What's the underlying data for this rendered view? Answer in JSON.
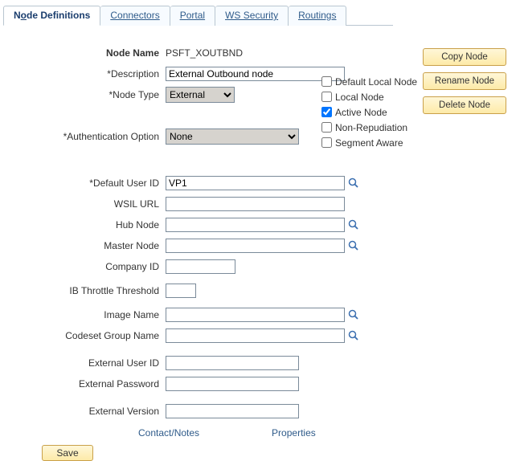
{
  "tabs": [
    {
      "label_pre": "N",
      "label_u": "o",
      "label_post": "de Definitions"
    },
    {
      "label_pre": "",
      "label_u": "C",
      "label_post": "onnectors"
    },
    {
      "label_pre": "",
      "label_u": "P",
      "label_post": "ortal"
    },
    {
      "label_pre": "",
      "label_u": "W",
      "label_post": "S Security"
    },
    {
      "label_pre": "",
      "label_u": "R",
      "label_post": "outings"
    }
  ],
  "buttons": {
    "copy": "Copy Node",
    "rename": "Rename Node",
    "delete": "Delete Node",
    "save": "Save"
  },
  "labels": {
    "node_name": "Node Name",
    "description": "*Description",
    "node_type": "*Node Type",
    "auth_option": "*Authentication Option",
    "default_user_id": "*Default User ID",
    "wsil_url": "WSIL URL",
    "hub_node": "Hub Node",
    "master_node": "Master Node",
    "company_id": "Company ID",
    "ib_throttle": "IB Throttle Threshold",
    "image_name": "Image Name",
    "codeset_group": "Codeset Group Name",
    "ext_user_id": "External User ID",
    "ext_password": "External Password",
    "ext_version": "External Version"
  },
  "values": {
    "node_name": "PSFT_XOUTBND",
    "description": "External Outbound node",
    "node_type": "External",
    "auth_option": "None",
    "default_user_id": "VP1",
    "wsil_url": "",
    "hub_node": "",
    "master_node": "",
    "company_id": "",
    "ib_throttle": "",
    "image_name": "",
    "codeset_group": "",
    "ext_user_id": "",
    "ext_password": "",
    "ext_version": ""
  },
  "checks": {
    "default_local": {
      "label": "Default Local Node",
      "checked": false
    },
    "local": {
      "label": "Local Node",
      "checked": false
    },
    "active": {
      "label": "Active Node",
      "checked": true
    },
    "nonrep": {
      "label": "Non-Repudiation",
      "checked": false
    },
    "segment": {
      "label": "Segment Aware",
      "checked": false
    }
  },
  "links": {
    "contact": "Contact/Notes",
    "properties": "Properties"
  }
}
